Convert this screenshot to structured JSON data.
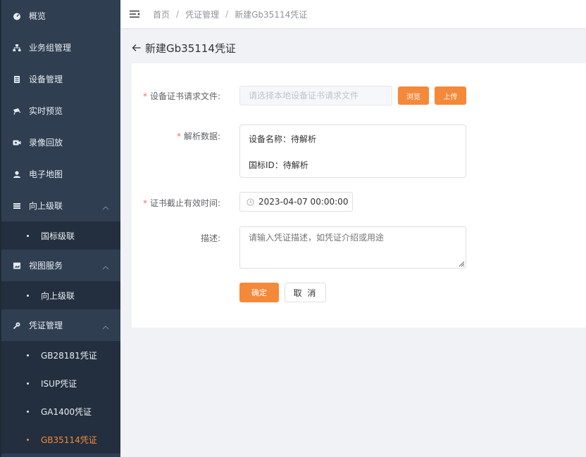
{
  "sidebar": {
    "items": [
      {
        "label": "概览",
        "icon": "dashboard-icon"
      },
      {
        "label": "业务组管理",
        "icon": "org-icon"
      },
      {
        "label": "设备管理",
        "icon": "device-icon"
      },
      {
        "label": "实时预览",
        "icon": "camera-icon"
      },
      {
        "label": "录像回放",
        "icon": "video-icon"
      },
      {
        "label": "电子地图",
        "icon": "map-pin-icon"
      },
      {
        "label": "向上级联",
        "icon": "cascade-icon",
        "children": [
          "国标级联"
        ]
      },
      {
        "label": "视图服务",
        "icon": "image-icon",
        "children": [
          "向上级联"
        ]
      },
      {
        "label": "凭证管理",
        "icon": "key-icon",
        "children": [
          "GB28181凭证",
          "ISUP凭证",
          "GA1400凭证",
          "GB35114凭证"
        ]
      }
    ],
    "active_item": "GB35114凭证",
    "active_color": "#f5893a"
  },
  "header": {
    "breadcrumb": [
      "首页",
      "凭证管理",
      "新建Gb35114凭证"
    ]
  },
  "page": {
    "title": "新建Gb35114凭证"
  },
  "form": {
    "file_label": "设备证书请求文件:",
    "file_placeholder": "请选择本地设备证书请求文件",
    "browse_label": "浏览",
    "upload_label": "上传",
    "parse_label": "解析数据:",
    "device_name_row": "设备名称：待解析",
    "gb_id_row": "国标ID：待解析",
    "expire_label": "证书截止有效时间:",
    "expire_value": "2023-04-07 00:00:00",
    "desc_label": "描述:",
    "desc_placeholder": "请输入凭证描述，如凭证介绍或用途",
    "confirm_label": "确定",
    "cancel_label": "取 消"
  },
  "colors": {
    "sidebar_bg": "#2f3e51",
    "submenu_bg": "#232f3e",
    "accent": "#f5893a",
    "required": "#f56c6c"
  }
}
